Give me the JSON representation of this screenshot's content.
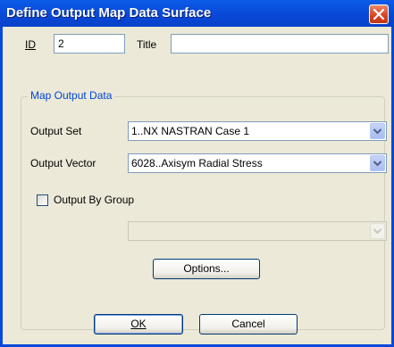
{
  "window": {
    "title": "Define Output Map Data Surface"
  },
  "fields": {
    "id_label": "ID",
    "id_value": "2",
    "title_label": "Title",
    "title_value": ""
  },
  "group": {
    "label": "Map Output Data",
    "output_set_label": "Output Set",
    "output_set_value": "1..NX NASTRAN Case 1",
    "output_vector_label": "Output Vector",
    "output_vector_value": "6028..Axisym Radial Stress",
    "output_by_group_label": "Output By Group",
    "output_by_group_checked": false,
    "group_select_value": "",
    "options_label": "Options..."
  },
  "buttons": {
    "ok_label": "OK",
    "cancel_label": "Cancel"
  },
  "icons": {
    "close": "close-icon",
    "dropdown": "chevron-down-icon",
    "check": "checkbox"
  }
}
